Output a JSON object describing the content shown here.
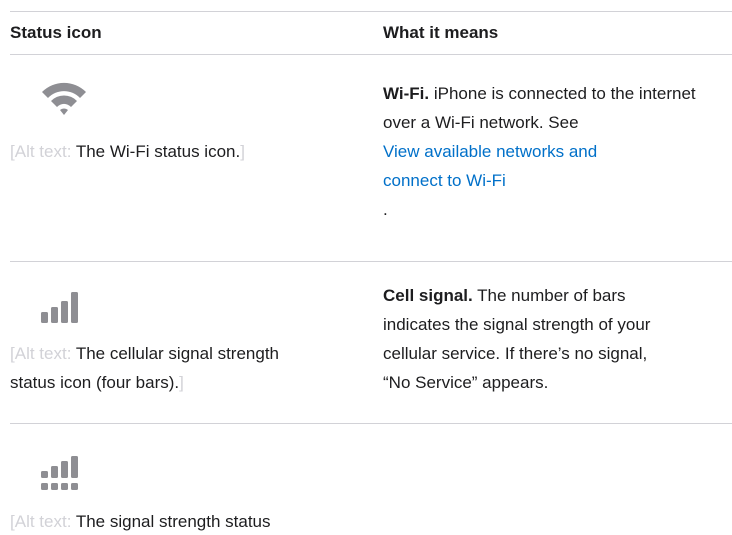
{
  "header": {
    "col1": "Status icon",
    "col2": "What it means"
  },
  "rows": [
    {
      "icon": "wifi-icon",
      "alt_open": "[",
      "alt_label": "Alt text:",
      "alt_text": " The Wi-Fi status icon.",
      "alt_close": "]",
      "title": "Wi-Fi.",
      "desc": " iPhone is connected to the internet over a Wi-Fi network. See ",
      "link_line1": "View available networks and",
      "link_line2": "connect to Wi-Fi",
      "after": "."
    },
    {
      "icon": "cellular-signal-icon",
      "alt_open": "[",
      "alt_label": "Alt text:",
      "alt_text_line1": " The cellular signal strength",
      "alt_text_line2": "status icon (four bars).",
      "alt_close": "]",
      "title": "Cell signal.",
      "desc_line1": " The number of bars",
      "desc_line2": "indicates the signal strength of your",
      "desc_line3": "cellular service. If there’s no signal,",
      "desc_line4": "“No Service” appears."
    },
    {
      "icon": "dual-sim-signal-icon",
      "alt_open": "[",
      "alt_label": "Alt text:",
      "alt_text_line1": " The signal strength status"
    }
  ],
  "colors": {
    "text": "#1d1d1f",
    "link": "#0070c9",
    "rule": "#d2d2d7",
    "icon": "#8e8e93"
  }
}
